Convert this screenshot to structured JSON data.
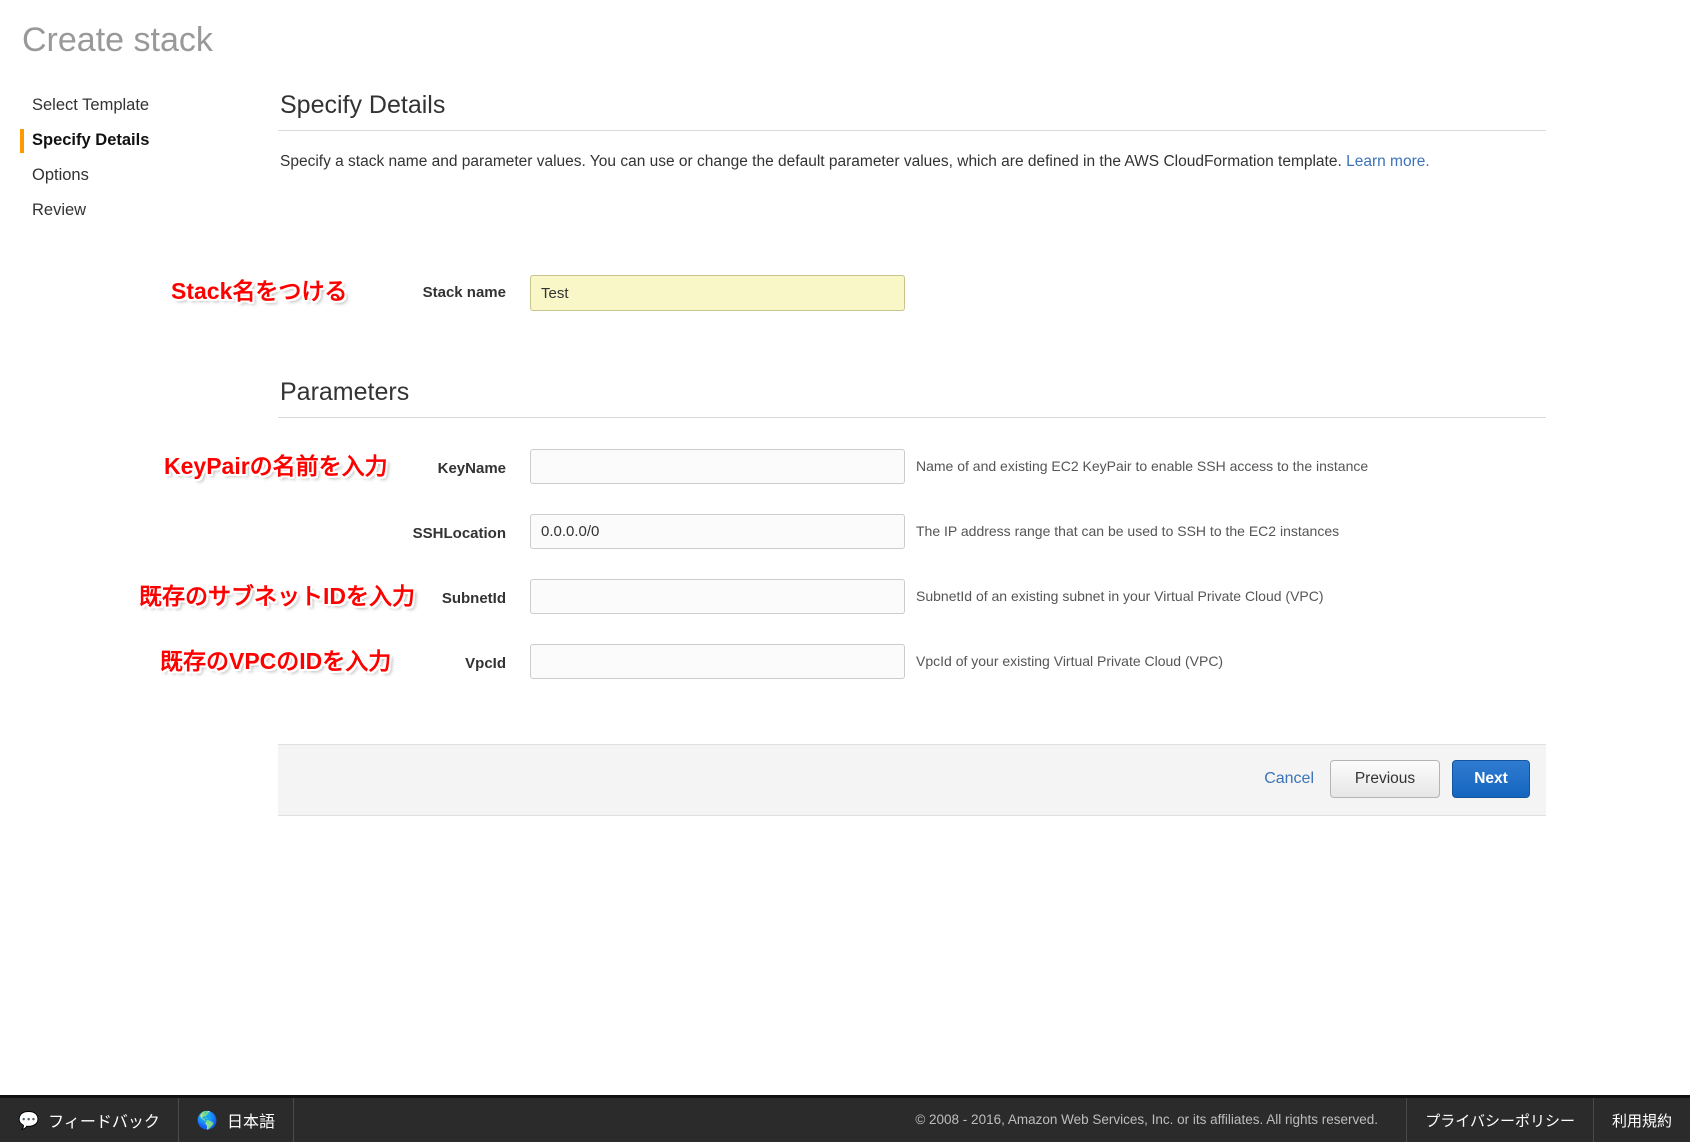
{
  "page": {
    "title": "Create stack"
  },
  "wizard": {
    "items": [
      {
        "label": "Select Template",
        "active": false
      },
      {
        "label": "Specify Details",
        "active": true
      },
      {
        "label": "Options",
        "active": false
      },
      {
        "label": "Review",
        "active": false
      }
    ]
  },
  "main": {
    "section_title": "Specify Details",
    "intro_text": "Specify a stack name and parameter values. You can use or change the default parameter values, which are defined in the AWS CloudFormation template. ",
    "intro_link": "Learn more.",
    "stack_name": {
      "label": "Stack name",
      "value": "Test",
      "placeholder": ""
    },
    "parameters_title": "Parameters",
    "parameters": [
      {
        "label": "KeyName",
        "value": "",
        "placeholder": "",
        "description": "Name of and existing EC2 KeyPair to enable SSH access to the instance"
      },
      {
        "label": "SSHLocation",
        "value": "0.0.0.0/0",
        "placeholder": "",
        "description": "The IP address range that can be used to SSH to the EC2 instances"
      },
      {
        "label": "SubnetId",
        "value": "",
        "placeholder": "",
        "description": "SubnetId of an existing subnet in your Virtual Private Cloud (VPC)"
      },
      {
        "label": "VpcId",
        "value": "",
        "placeholder": "",
        "description": "VpcId of your existing Virtual Private Cloud (VPC)"
      }
    ]
  },
  "annotations": [
    {
      "text": "Stack名をつける"
    },
    {
      "text": "KeyPairの名前を入力"
    },
    {
      "text": "既存のサブネットIDを入力"
    },
    {
      "text": "既存のVPCのIDを入力"
    }
  ],
  "buttonbar": {
    "cancel": "Cancel",
    "previous": "Previous",
    "next": "Next"
  },
  "bottombar": {
    "feedback": "フィードバック",
    "feedback_icon": "speech-bubble-icon",
    "language": "日本語",
    "language_icon": "globe-icon",
    "copyright": "© 2008 - 2016, Amazon Web Services, Inc. or its affiliates. All rights reserved.",
    "privacy": "プライバシーポリシー",
    "terms": "利用規約"
  },
  "colors": {
    "accent_orange": "#ff9900",
    "link_blue": "#3b73b9",
    "annotation_red": "#ff0000",
    "highlight_yellow": "#f9f6c8",
    "next_blue": "#1565bf"
  }
}
